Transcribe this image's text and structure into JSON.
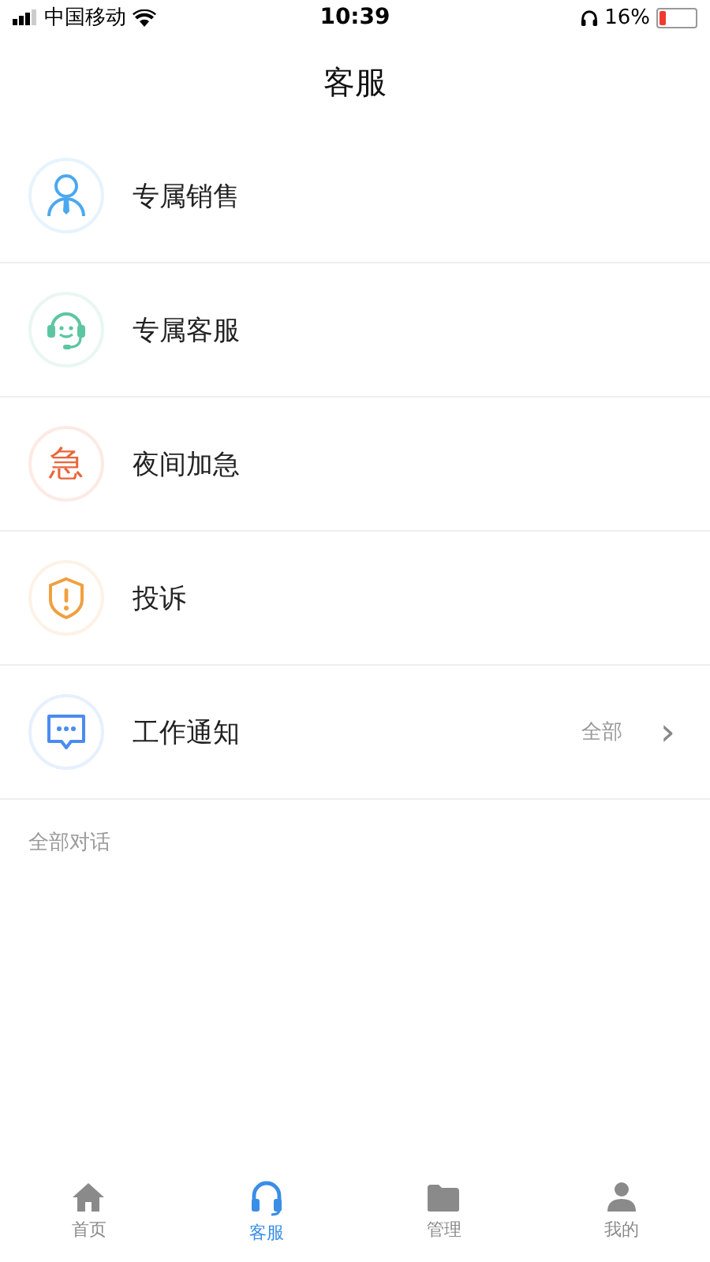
{
  "status_bar": {
    "carrier": "中国移动",
    "time": "10:39",
    "battery": "16%"
  },
  "title": "客服",
  "items": [
    {
      "label": "专属销售",
      "kind": "person",
      "color": "#4aa8f0"
    },
    {
      "label": "专属客服",
      "kind": "headset",
      "color": "#5cc6a0"
    },
    {
      "label": "夜间加急",
      "kind": "glyph",
      "icon_text": "急",
      "color": "#e8663c"
    },
    {
      "label": "投诉",
      "kind": "shield",
      "color": "#f0a040"
    },
    {
      "label": "工作通知",
      "kind": "chat",
      "color": "#4a8cf0",
      "action": "全部",
      "chevron": "›"
    }
  ],
  "section": "全部对话",
  "tabs": [
    {
      "label": "首页",
      "kind": "home",
      "selected": false
    },
    {
      "label": "客服",
      "kind": "headset",
      "selected": true
    },
    {
      "label": "管理",
      "kind": "folder",
      "selected": false
    },
    {
      "label": "我的",
      "kind": "user",
      "selected": false
    }
  ]
}
